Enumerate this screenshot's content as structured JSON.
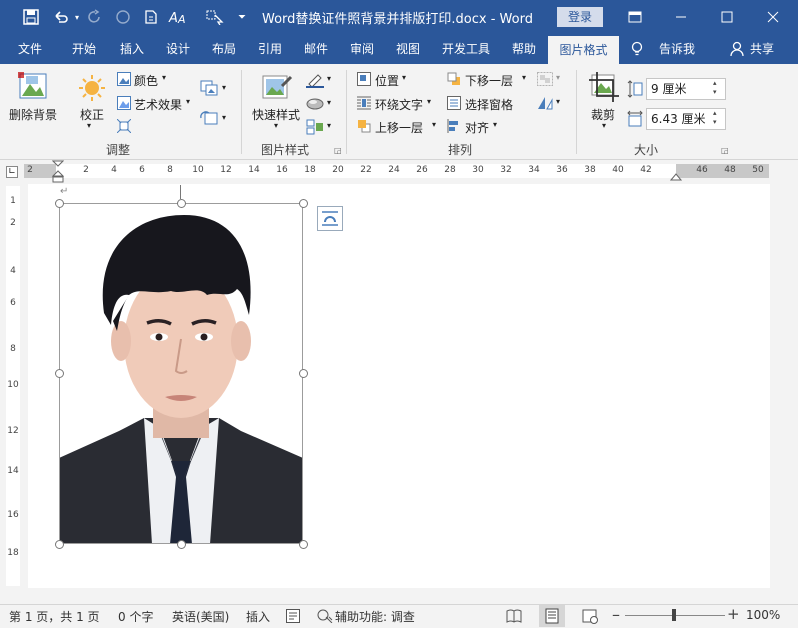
{
  "titlebar": {
    "document_title": "Word替换证件照背景并排版打印.docx - Word",
    "login_label": "登录",
    "bg_color": "#2b579a"
  },
  "tabs": [
    {
      "label": "文件"
    },
    {
      "label": "开始"
    },
    {
      "label": "插入"
    },
    {
      "label": "设计"
    },
    {
      "label": "布局"
    },
    {
      "label": "引用"
    },
    {
      "label": "邮件"
    },
    {
      "label": "审阅"
    },
    {
      "label": "视图"
    },
    {
      "label": "开发工具"
    },
    {
      "label": "帮助"
    },
    {
      "label": "图片格式",
      "active": true
    }
  ],
  "tell_me": "告诉我",
  "share": "共享",
  "ribbon": {
    "adjust": {
      "remove_bg": "删除背景",
      "correct": "校正",
      "color": "颜色",
      "artistic": "艺术效果",
      "group_label": "调整"
    },
    "picture_styles": {
      "quick_styles": "快速样式",
      "group_label": "图片样式"
    },
    "arrange": {
      "position": "位置",
      "wrap_text": "环绕文字",
      "bring_forward": "上移一层",
      "send_backward": "下移一层",
      "selection_pane": "选择窗格",
      "align": "对齐",
      "group_label": "排列"
    },
    "size": {
      "crop": "裁剪",
      "height": "9 厘米",
      "width": "6.43 厘米",
      "group_label": "大小"
    }
  },
  "ruler": {
    "h_numbers": [
      "2",
      "2",
      "4",
      "6",
      "8",
      "10",
      "12",
      "14",
      "16",
      "18",
      "20",
      "22",
      "24",
      "26",
      "28",
      "30",
      "32",
      "34",
      "36",
      "38",
      "40",
      "42",
      "46",
      "48",
      "50"
    ],
    "v_numbers": [
      "1",
      "2",
      "4",
      "6",
      "8",
      "10",
      "12",
      "14",
      "16",
      "18"
    ]
  },
  "statusbar": {
    "page": "第 1 页，共 1 页",
    "words": "0 个字",
    "language": "英语(美国)",
    "mode": "插入",
    "accessibility": "辅助功能: 调查",
    "zoom": "100%",
    "zoom_level": 1.0
  },
  "icons": [
    "save-icon",
    "undo-icon",
    "redo-icon",
    "touch-mode-icon",
    "new-doc-icon",
    "font-icon",
    "select-icon",
    "customize-icon",
    "restore-icon",
    "minimize-icon",
    "maximize-icon",
    "close-icon",
    "lightbulb-icon",
    "person-icon",
    "layout-options-icon"
  ]
}
